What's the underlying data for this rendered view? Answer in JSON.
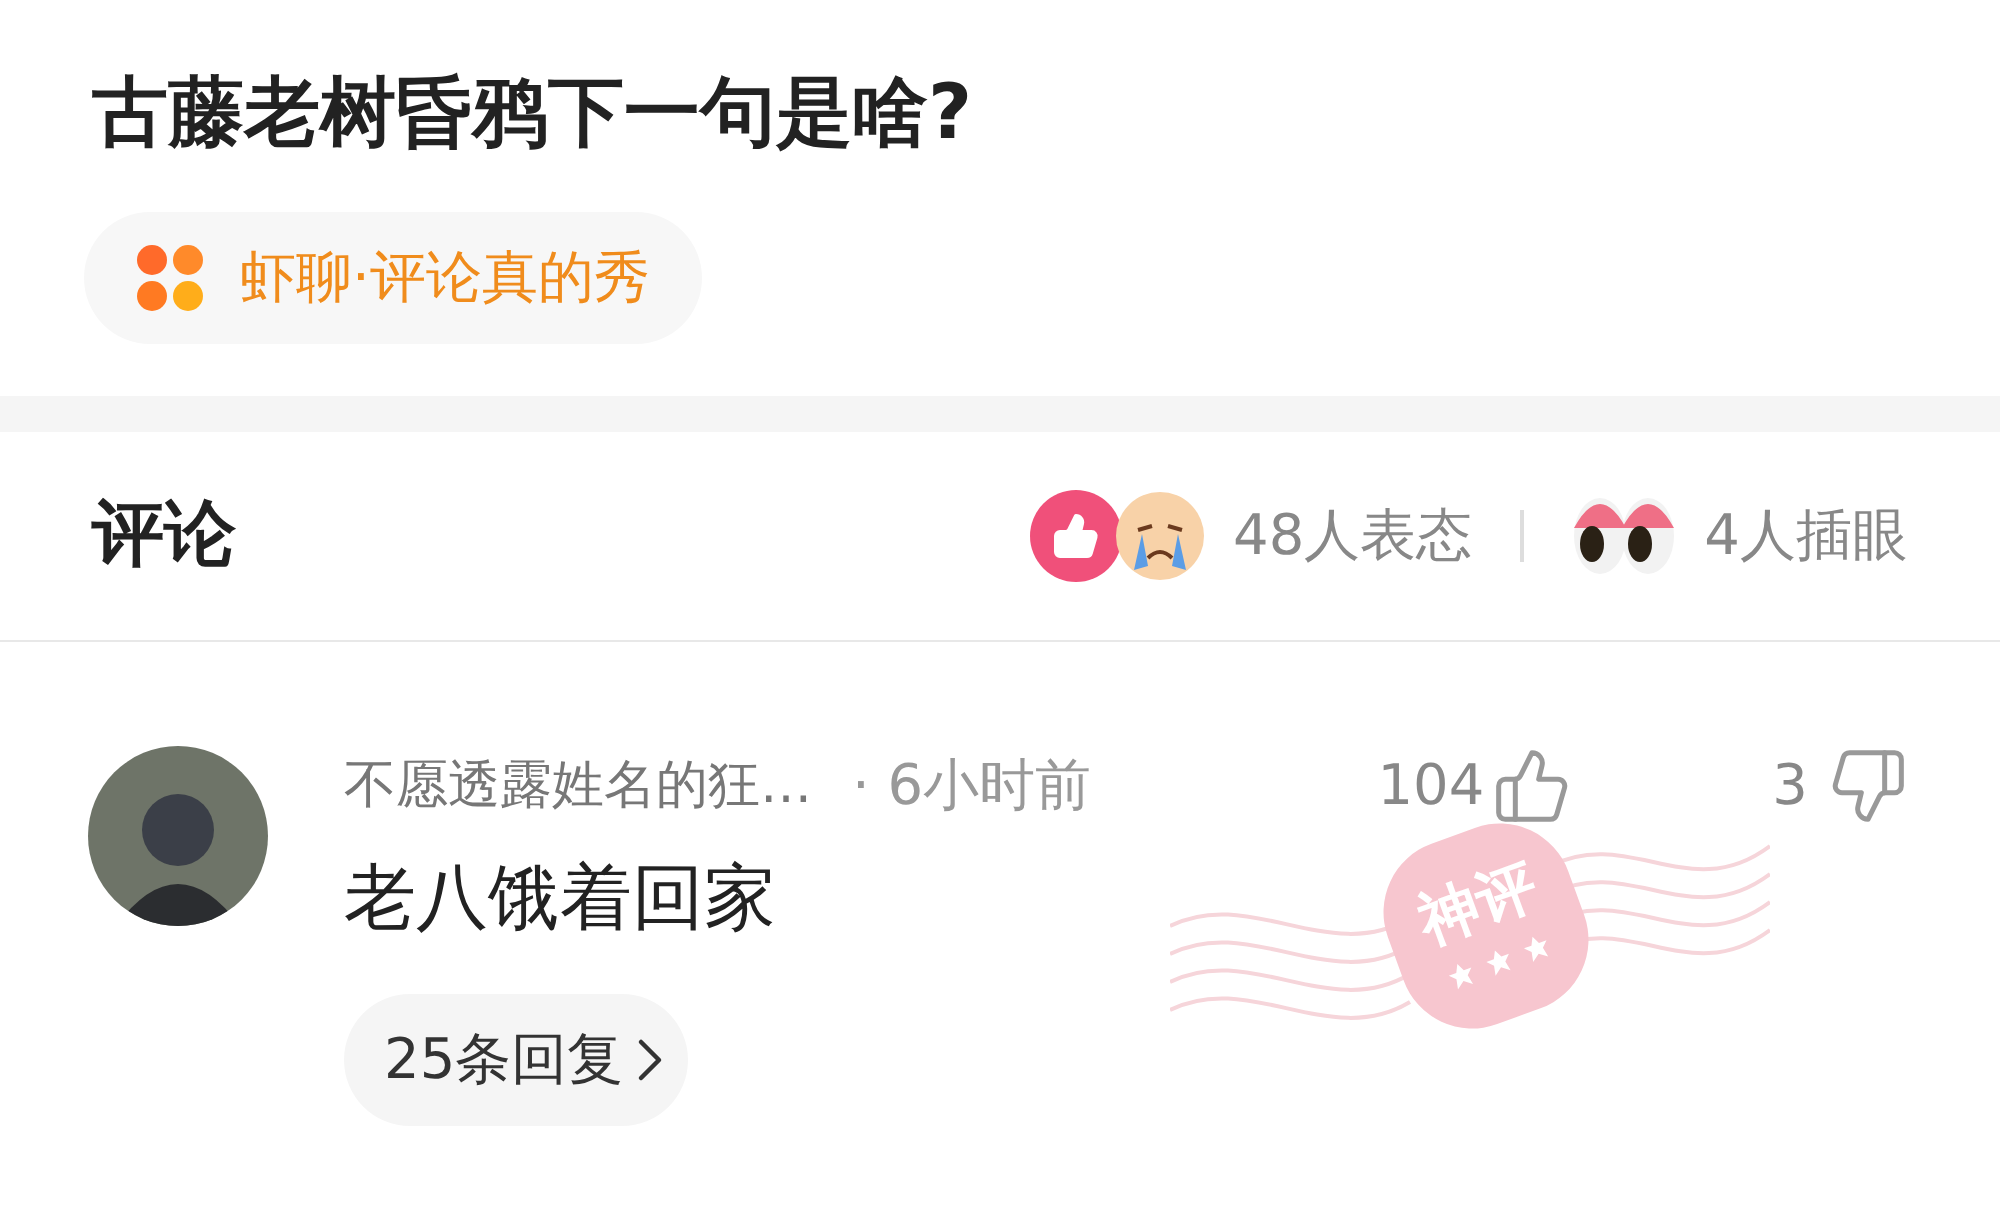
{
  "question": {
    "title": "古藤老树昏鸦下一句是啥?"
  },
  "topic": {
    "label": "虾聊·评论真的秀"
  },
  "comments_header": {
    "title": "评论",
    "reactions": "48人表态",
    "eyes": "4人插眼"
  },
  "comments": [
    {
      "username": "不愿透露姓名的狂…",
      "time": "· 6小时前",
      "likes": "104",
      "dislikes": "3",
      "text": "老八饿着回家",
      "badge": "神评",
      "replies": "25条回复"
    }
  ]
}
